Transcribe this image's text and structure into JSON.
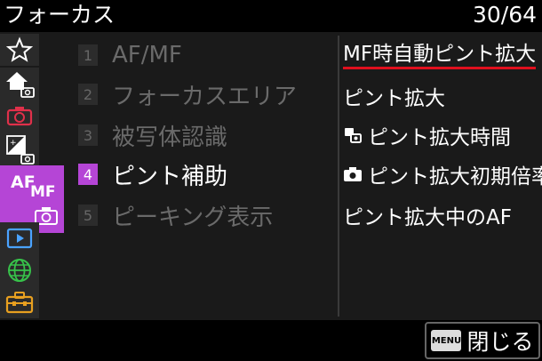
{
  "header": {
    "title": "フォーカス",
    "page_count": "30/64"
  },
  "sidebar": {
    "items": [
      {
        "icon": "star-icon"
      },
      {
        "icon": "home-camera-icon"
      },
      {
        "icon": "camera-icon"
      },
      {
        "icon": "exposure-camera-icon"
      },
      {
        "icon": "af-mf-camera-icon",
        "label_af": "AF",
        "label_mf": "MF"
      },
      {
        "icon": "playback-icon"
      },
      {
        "icon": "network-globe-icon"
      },
      {
        "icon": "toolbox-icon"
      }
    ]
  },
  "categories": [
    {
      "num": "1",
      "label": "AF/MF"
    },
    {
      "num": "2",
      "label": "フォーカスエリア"
    },
    {
      "num": "3",
      "label": "被写体認識"
    },
    {
      "num": "4",
      "label": "ピント補助"
    },
    {
      "num": "5",
      "label": "ピーキング表示"
    }
  ],
  "submenu": [
    {
      "label": "MF時自動ピント拡大"
    },
    {
      "label": "ピント拡大"
    },
    {
      "label": "ピント拡大時間",
      "icon": "movie-still-icon"
    },
    {
      "label": "ピント拡大初期倍率",
      "icon": "camera-small-icon"
    },
    {
      "label": "ピント拡大中のAF"
    }
  ],
  "footer": {
    "menu_key": "MENU",
    "close_label": "閉じる"
  },
  "colors": {
    "accent": "#b545d6",
    "highlight_underline": "#e0101e"
  }
}
